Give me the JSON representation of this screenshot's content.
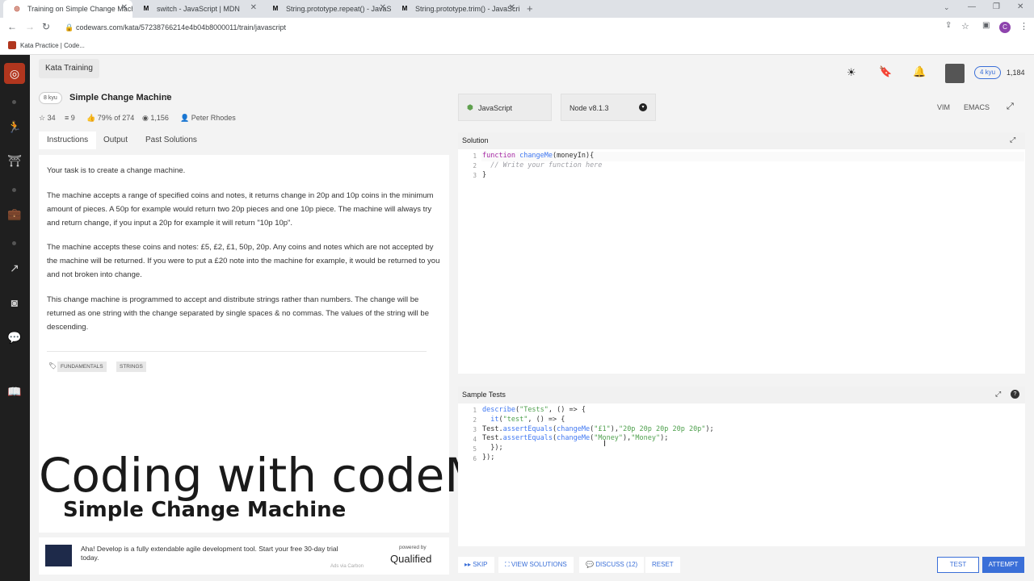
{
  "browser": {
    "tabs": [
      {
        "label": "Training on Simple Change Mach",
        "icon": "codewars-icon",
        "active": true
      },
      {
        "label": "switch - JavaScript | MDN",
        "icon": "mdn-icon",
        "active": false
      },
      {
        "label": "String.prototype.repeat() - JavaScr",
        "icon": "mdn-icon",
        "active": false
      },
      {
        "label": "String.prototype.trim() - JavaScri",
        "icon": "mdn-icon",
        "active": false
      }
    ],
    "url": "codewars.com/kata/57238766214e4b04b8000011/train/javascript",
    "bookmark": "Kata Practice | Code...",
    "profile_initial": "C"
  },
  "header": {
    "section": "Kata Training",
    "rank": "4 kyu",
    "honor": "1,184"
  },
  "kata": {
    "kyu": "8 kyu",
    "title": "Simple Change Machine",
    "stars": "34",
    "collections": "9",
    "satisfaction": "79% of 274",
    "completions": "1,156",
    "author": "Peter Rhodes"
  },
  "tabs": {
    "instructions": "Instructions",
    "output": "Output",
    "past_solutions": "Past Solutions"
  },
  "instructions": {
    "p1": "Your task is to create a change machine.",
    "p2": "The machine accepts a range of specified coins and notes, it returns change in 20p and 10p coins in the minimum amount of pieces. A 50p for example would return two 20p pieces and one 10p piece. The machine will always try and return change, if you input a 20p for example it will return \"10p 10p\".",
    "p3": "The machine accepts these coins and notes: £5, £2, £1, 50p, 20p. Any coins and notes which are not accepted by the machine will be returned. If you were to put a £20 note into the machine for example, it would be returned to you and not broken into change.",
    "p4": "This change machine is programmed to accept and distribute strings rather than numbers. The change will be returned as one string with the change separated by single spaces & no commas. The values of the string will be descending.",
    "tags": [
      "FUNDAMENTALS",
      "STRINGS"
    ]
  },
  "overlay": {
    "channel": "Coding with codeManS",
    "video_title": "Simple Change Machine"
  },
  "ad": {
    "text": "Aha! Develop is a fully extendable agile development tool. Start your free 30-day trial today.",
    "powered_by": "powered by",
    "brand": "Qualified",
    "via": "Ads via Carbon"
  },
  "editor": {
    "language": "JavaScript",
    "version": "Node v8.1.3",
    "vim": "VIM",
    "emacs": "EMACS",
    "solution_title": "Solution",
    "solution_lines": [
      "1",
      "2",
      "3"
    ],
    "tests_title": "Sample Tests",
    "tests_lines": [
      "1",
      "2",
      "3",
      "4",
      "5",
      "6"
    ]
  },
  "actions": {
    "skip": "SKIP",
    "view_solutions": "VIEW SOLUTIONS",
    "discuss": "DISCUSS (12)",
    "reset": "RESET",
    "test": "TEST",
    "attempt": "ATTEMPT"
  },
  "colors": {
    "accent_blue": "#3a6fd8",
    "sidebar_dark": "#1f1f1f",
    "codewars_red": "#b1361e"
  }
}
